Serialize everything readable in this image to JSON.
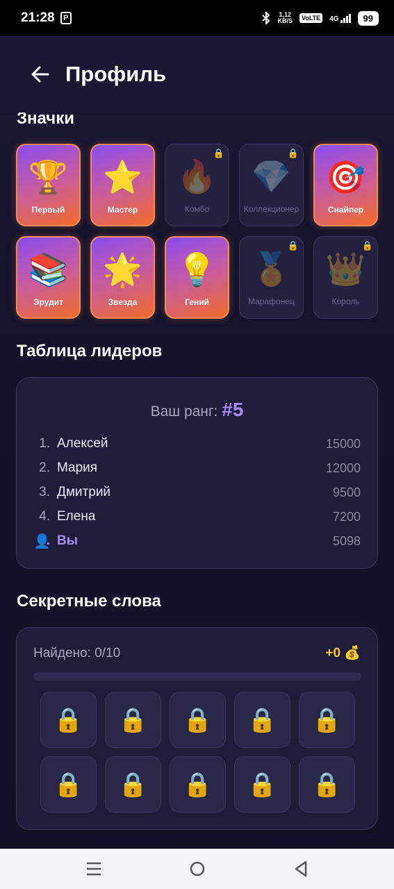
{
  "status_bar": {
    "time": "21:28",
    "speed_top": "1,12",
    "speed_bottom": "KB/S",
    "volte": "VoLTE",
    "network": "4G",
    "battery": "99"
  },
  "header": {
    "title": "Профиль"
  },
  "badges_section": {
    "title": "Значки",
    "items": [
      {
        "label": "Первый",
        "emoji": "🏆",
        "locked": false
      },
      {
        "label": "Мастер",
        "emoji": "⭐",
        "locked": false
      },
      {
        "label": "Комбо",
        "emoji": "🔥",
        "locked": true
      },
      {
        "label": "Коллекционер",
        "emoji": "💎",
        "locked": true
      },
      {
        "label": "Снайпер",
        "emoji": "🎯",
        "locked": false
      },
      {
        "label": "Эрудит",
        "emoji": "📚",
        "locked": false
      },
      {
        "label": "Звезда",
        "emoji": "🌟",
        "locked": false
      },
      {
        "label": "Гений",
        "emoji": "💡",
        "locked": false
      },
      {
        "label": "Марафонец",
        "emoji": "🏅",
        "locked": true
      },
      {
        "label": "Король",
        "emoji": "👑",
        "locked": true
      }
    ]
  },
  "leaderboard": {
    "title": "Таблица лидеров",
    "rank_label": "Ваш ранг:",
    "rank_value": "#5",
    "rows": [
      {
        "num": "1.",
        "name": "Алексей",
        "score": "15000"
      },
      {
        "num": "2.",
        "name": "Мария",
        "score": "12000"
      },
      {
        "num": "3.",
        "name": "Дмитрий",
        "score": "9500"
      },
      {
        "num": "4.",
        "name": "Елена",
        "score": "7200"
      },
      {
        "num": "5.",
        "name": "Вы",
        "score": "5098"
      }
    ]
  },
  "secret_words": {
    "title": "Секретные слова",
    "found": "Найдено: 0/10",
    "coins": "+0 💰",
    "progress_fraction": 0,
    "lock_emoji": "🔒",
    "count": 10
  },
  "colors": {
    "accent": "#a78bfa",
    "gold": "#f5c542",
    "badge_gradient_start": "#8a4cf0",
    "badge_gradient_end": "#f26b2a",
    "background": "#15132b"
  }
}
